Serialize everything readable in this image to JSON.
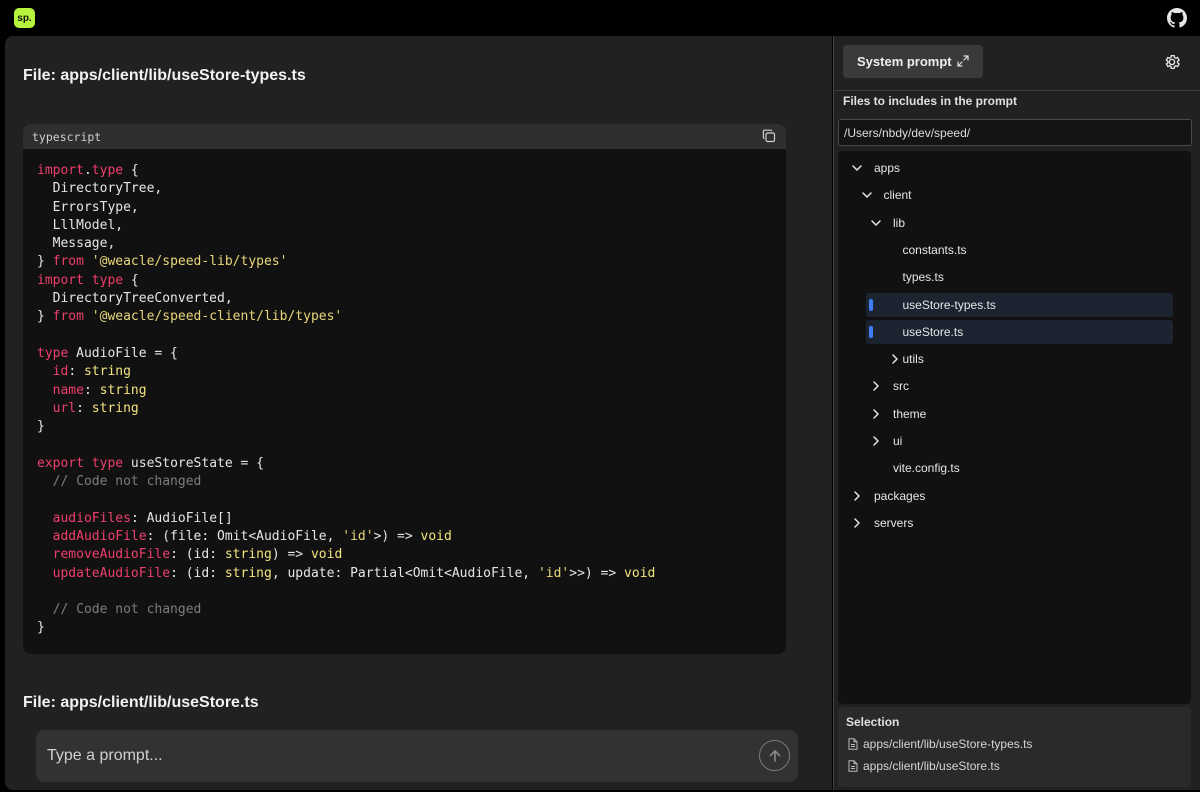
{
  "app": {
    "logo_text": "sp.",
    "github_icon": "github-icon"
  },
  "main": {
    "files": [
      {
        "heading": "File: apps/client/lib/useStore-types.ts"
      },
      {
        "heading": "File: apps/client/lib/useStore.ts"
      }
    ],
    "code_block": {
      "language": "typescript",
      "copy_icon": "copy-icon",
      "lines": [
        [
          [
            "kw",
            "import"
          ],
          [
            "",
            "."
          ],
          [
            "kw",
            "type"
          ],
          [
            "",
            " {"
          ]
        ],
        [
          [
            "",
            "  DirectoryTree,"
          ]
        ],
        [
          [
            "",
            "  ErrorsType,"
          ]
        ],
        [
          [
            "",
            "  LllModel,"
          ]
        ],
        [
          [
            "",
            "  Message,"
          ]
        ],
        [
          [
            "",
            "} "
          ],
          [
            "kw",
            "from"
          ],
          [
            "",
            " "
          ],
          [
            "str",
            "'@weacle/speed-lib/types'"
          ]
        ],
        [
          [
            "kw",
            "import"
          ],
          [
            "",
            " "
          ],
          [
            "kw",
            "type"
          ],
          [
            "",
            " {"
          ]
        ],
        [
          [
            "",
            "  DirectoryTreeConverted,"
          ]
        ],
        [
          [
            "",
            "} "
          ],
          [
            "kw",
            "from"
          ],
          [
            "",
            " "
          ],
          [
            "str",
            "'@weacle/speed-client/lib/types'"
          ]
        ],
        [
          [
            "",
            ""
          ]
        ],
        [
          [
            "kw",
            "type"
          ],
          [
            "",
            " AudioFile = {"
          ]
        ],
        [
          [
            "",
            "  "
          ],
          [
            "prop",
            "id"
          ],
          [
            "",
            ": "
          ],
          [
            "ty",
            "string"
          ]
        ],
        [
          [
            "",
            "  "
          ],
          [
            "prop",
            "name"
          ],
          [
            "",
            ": "
          ],
          [
            "ty",
            "string"
          ]
        ],
        [
          [
            "",
            "  "
          ],
          [
            "prop",
            "url"
          ],
          [
            "",
            ": "
          ],
          [
            "ty",
            "string"
          ]
        ],
        [
          [
            "",
            "}"
          ]
        ],
        [
          [
            "",
            ""
          ]
        ],
        [
          [
            "kw",
            "export"
          ],
          [
            "",
            " "
          ],
          [
            "kw",
            "type"
          ],
          [
            "",
            " useStoreState = {"
          ]
        ],
        [
          [
            "cm",
            "  // Code not changed"
          ]
        ],
        [
          [
            "",
            ""
          ]
        ],
        [
          [
            "",
            "  "
          ],
          [
            "prop",
            "audioFiles"
          ],
          [
            "",
            ": AudioFile[]"
          ]
        ],
        [
          [
            "",
            "  "
          ],
          [
            "prop",
            "addAudioFile"
          ],
          [
            "",
            ": (file: Omit<AudioFile, "
          ],
          [
            "str",
            "'id'"
          ],
          [
            "",
            ">) => "
          ],
          [
            "ty",
            "void"
          ]
        ],
        [
          [
            "",
            "  "
          ],
          [
            "prop",
            "removeAudioFile"
          ],
          [
            "",
            ": (id: "
          ],
          [
            "ty",
            "string"
          ],
          [
            "",
            ") => "
          ],
          [
            "ty",
            "void"
          ]
        ],
        [
          [
            "",
            "  "
          ],
          [
            "prop",
            "updateAudioFile"
          ],
          [
            "",
            ": (id: "
          ],
          [
            "ty",
            "string"
          ],
          [
            "",
            ", update: Partial<Omit<AudioFile, "
          ],
          [
            "str",
            "'id'"
          ],
          [
            "",
            ">>) => "
          ],
          [
            "ty",
            "void"
          ]
        ],
        [
          [
            "",
            ""
          ]
        ],
        [
          [
            "cm",
            "  // Code not changed"
          ]
        ],
        [
          [
            "",
            "}"
          ]
        ]
      ]
    },
    "prompt": {
      "placeholder": "Type a prompt...",
      "send_icon": "arrow-up-icon"
    }
  },
  "sidebar": {
    "system_prompt_label": "System prompt",
    "expand_icon": "expand-icon",
    "settings_icon": "gear-icon",
    "files_title": "Files to includes in the prompt",
    "root_path": "/Users/nbdy/dev/speed/",
    "tree": [
      {
        "label": "apps",
        "depth": 0,
        "chevron": "down",
        "selected": false
      },
      {
        "label": "client",
        "depth": 1,
        "chevron": "down",
        "selected": false
      },
      {
        "label": "lib",
        "depth": 2,
        "chevron": "down",
        "selected": false
      },
      {
        "label": "constants.ts",
        "depth": 3,
        "chevron": "none",
        "selected": false
      },
      {
        "label": "types.ts",
        "depth": 3,
        "chevron": "none",
        "selected": false
      },
      {
        "label": "useStore-types.ts",
        "depth": 3,
        "chevron": "none",
        "selected": true
      },
      {
        "label": "useStore.ts",
        "depth": 3,
        "chevron": "none",
        "selected": true
      },
      {
        "label": "utils",
        "depth": 3,
        "chevron": "right",
        "selected": false,
        "shift_chevron": true
      },
      {
        "label": "src",
        "depth": 2,
        "chevron": "right",
        "selected": false
      },
      {
        "label": "theme",
        "depth": 2,
        "chevron": "right",
        "selected": false
      },
      {
        "label": "ui",
        "depth": 2,
        "chevron": "right",
        "selected": false
      },
      {
        "label": "vite.config.ts",
        "depth": 2,
        "chevron": "none",
        "selected": false
      },
      {
        "label": "packages",
        "depth": 0,
        "chevron": "right",
        "selected": false
      },
      {
        "label": "servers",
        "depth": 0,
        "chevron": "right",
        "selected": false
      }
    ],
    "selection": {
      "title": "Selection",
      "items": [
        "apps/client/lib/useStore-types.ts",
        "apps/client/lib/useStore.ts"
      ]
    }
  },
  "colors": {
    "accent": "#b6f33c",
    "selection_marker": "#3f7ef7",
    "keyword": "#ee3f6c",
    "string": "#e9d67a"
  }
}
